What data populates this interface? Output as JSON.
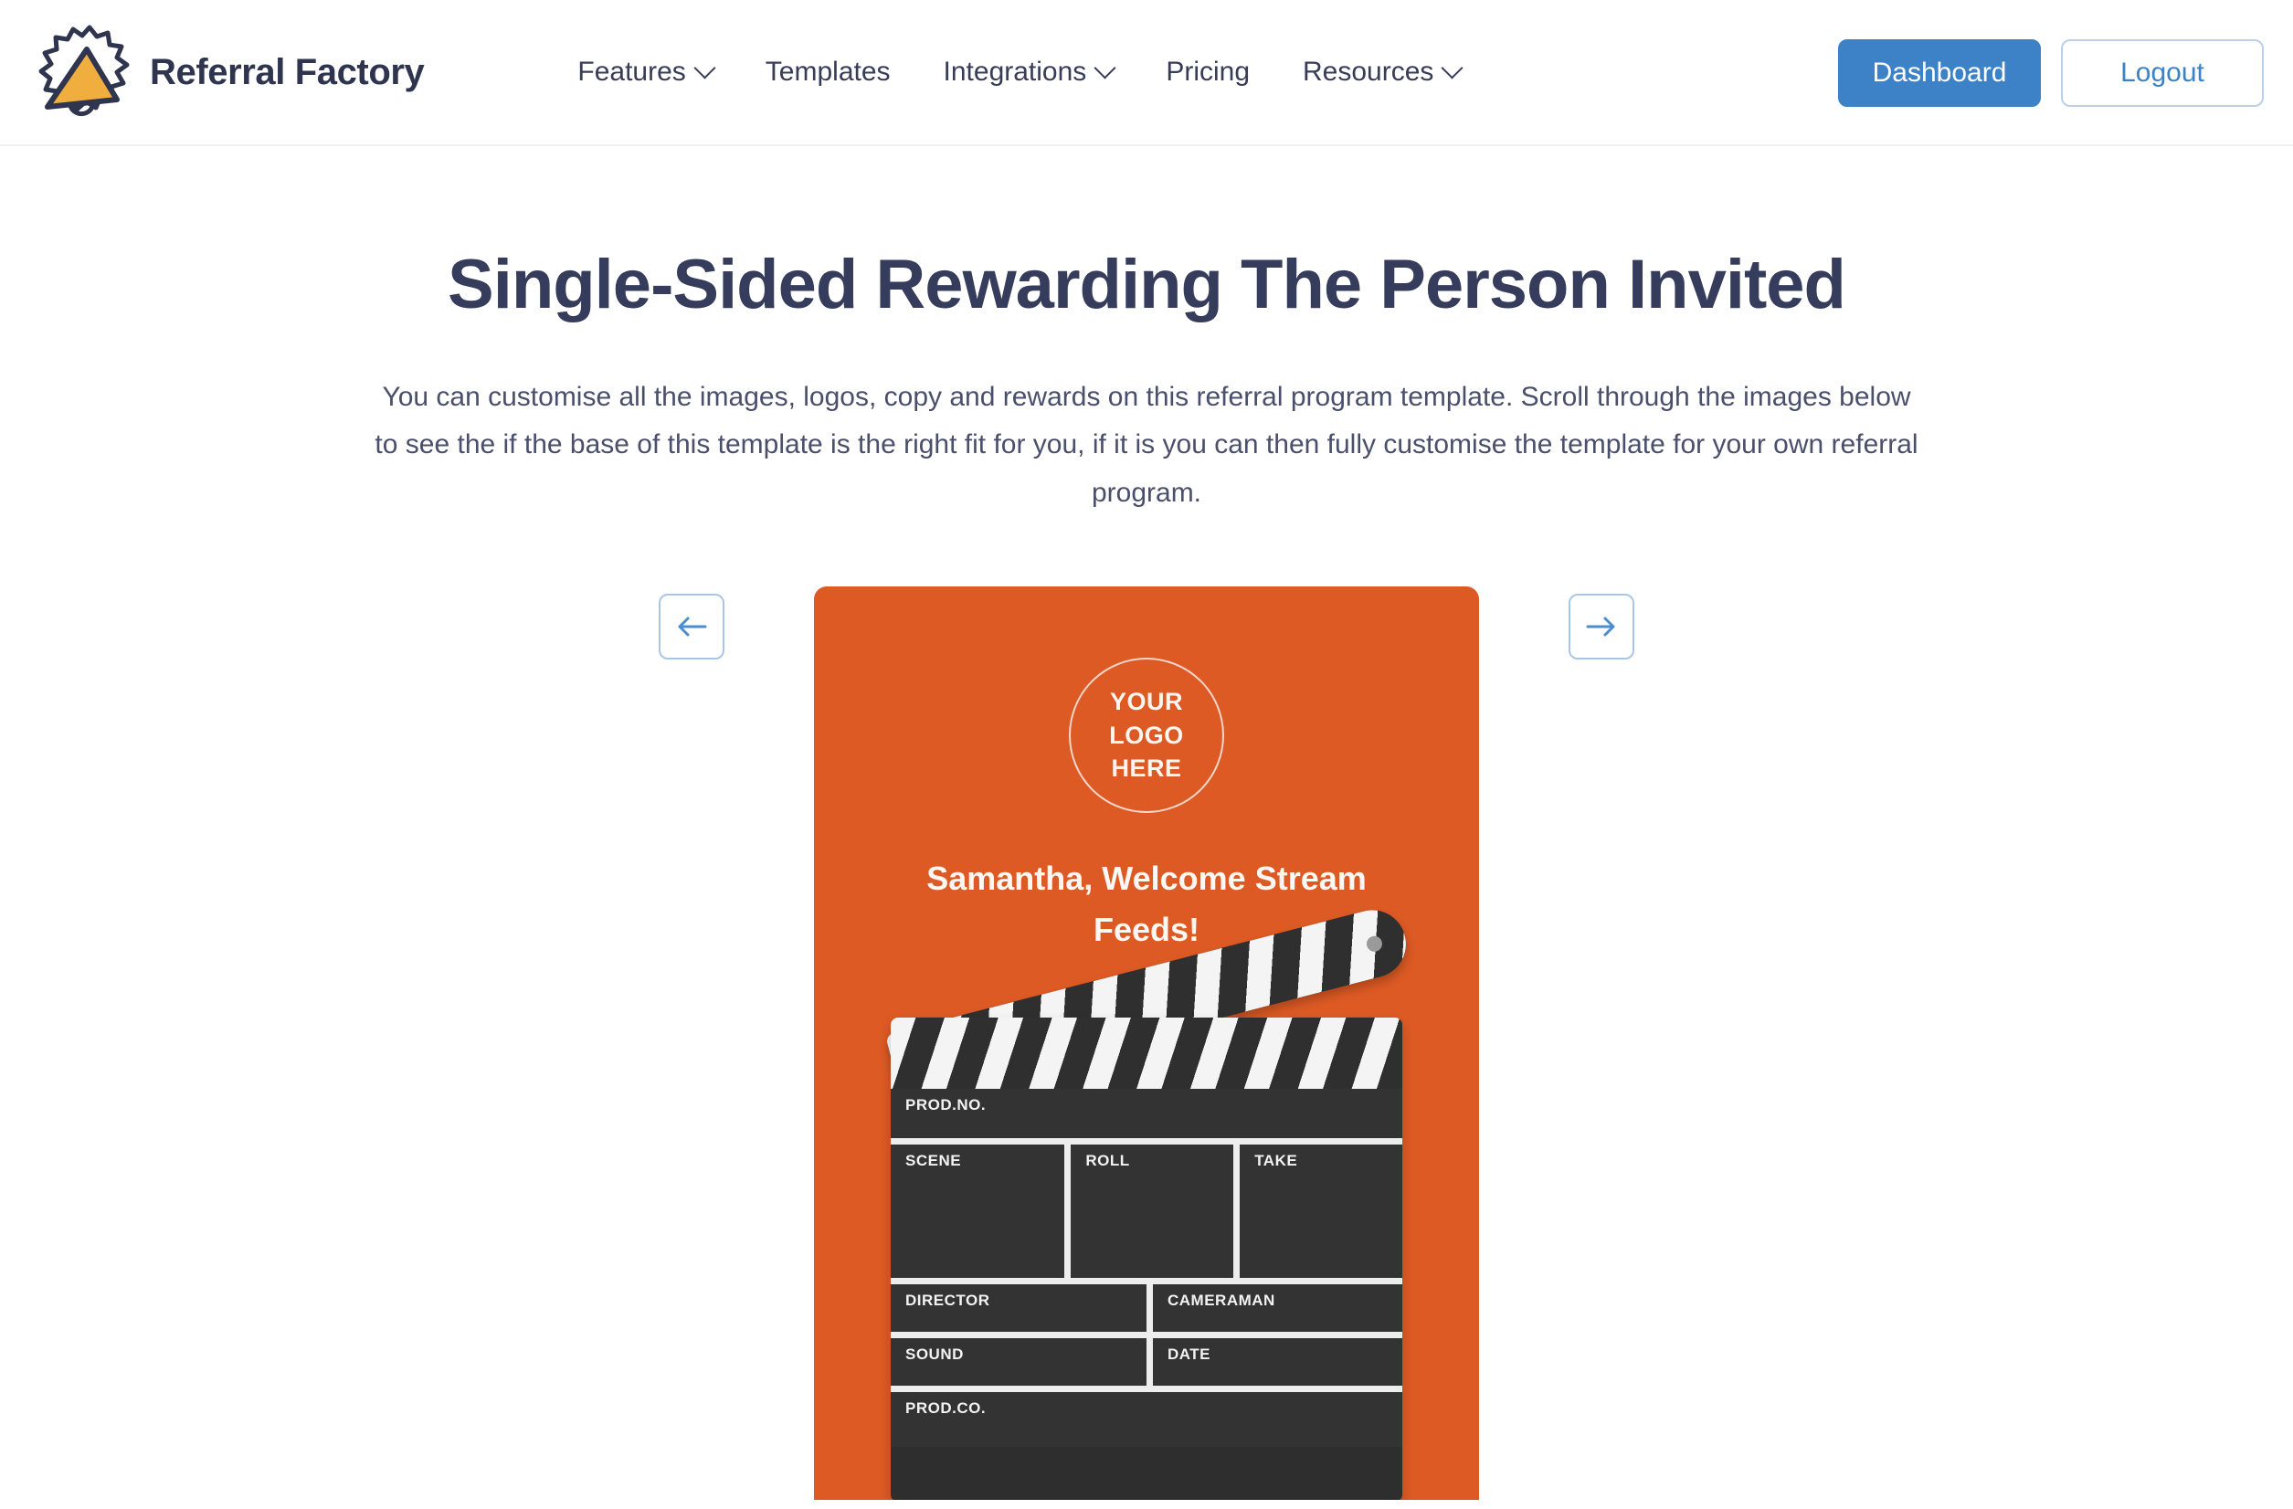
{
  "header": {
    "brand": {
      "name": "Referral Factory",
      "logo_icon": "megaphone-burst-icon"
    },
    "nav": [
      {
        "label": "Features",
        "has_dropdown": true
      },
      {
        "label": "Templates",
        "has_dropdown": false
      },
      {
        "label": "Integrations",
        "has_dropdown": true
      },
      {
        "label": "Pricing",
        "has_dropdown": false
      },
      {
        "label": "Resources",
        "has_dropdown": true
      }
    ],
    "actions": {
      "dashboard_label": "Dashboard",
      "logout_label": "Logout"
    }
  },
  "main": {
    "title": "Single-Sided Rewarding The Person Invited",
    "description": "You can customise all the images, logos, copy and rewards on this referral program template. Scroll through the images below to see the if the base of this template is the right fit for you, if it is you can then fully customise the template for your own referral program."
  },
  "carousel": {
    "prev_icon": "arrow-left-icon",
    "next_icon": "arrow-right-icon",
    "slide": {
      "logo_placeholder": {
        "line1": "YOUR",
        "line2": "LOGO",
        "line3": "HERE"
      },
      "headline": "Samantha, Welcome Stream Feeds!",
      "illustration": {
        "name": "clapperboard-illustration",
        "fields": {
          "prod_no": "PROD.NO.",
          "scene": "SCENE",
          "roll": "ROLL",
          "take": "TAKE",
          "director": "DIRECTOR",
          "cameraman": "CAMERAMAN",
          "sound": "SOUND",
          "date": "DATE",
          "prod_co": "PROD.CO."
        }
      }
    }
  },
  "colors": {
    "brand_navy": "#2f344f",
    "accent_blue": "#3d82c7",
    "slide_orange": "#dd5a24",
    "logo_yellow": "#f0ae3f",
    "clapper_dark": "#2e2e2e"
  }
}
